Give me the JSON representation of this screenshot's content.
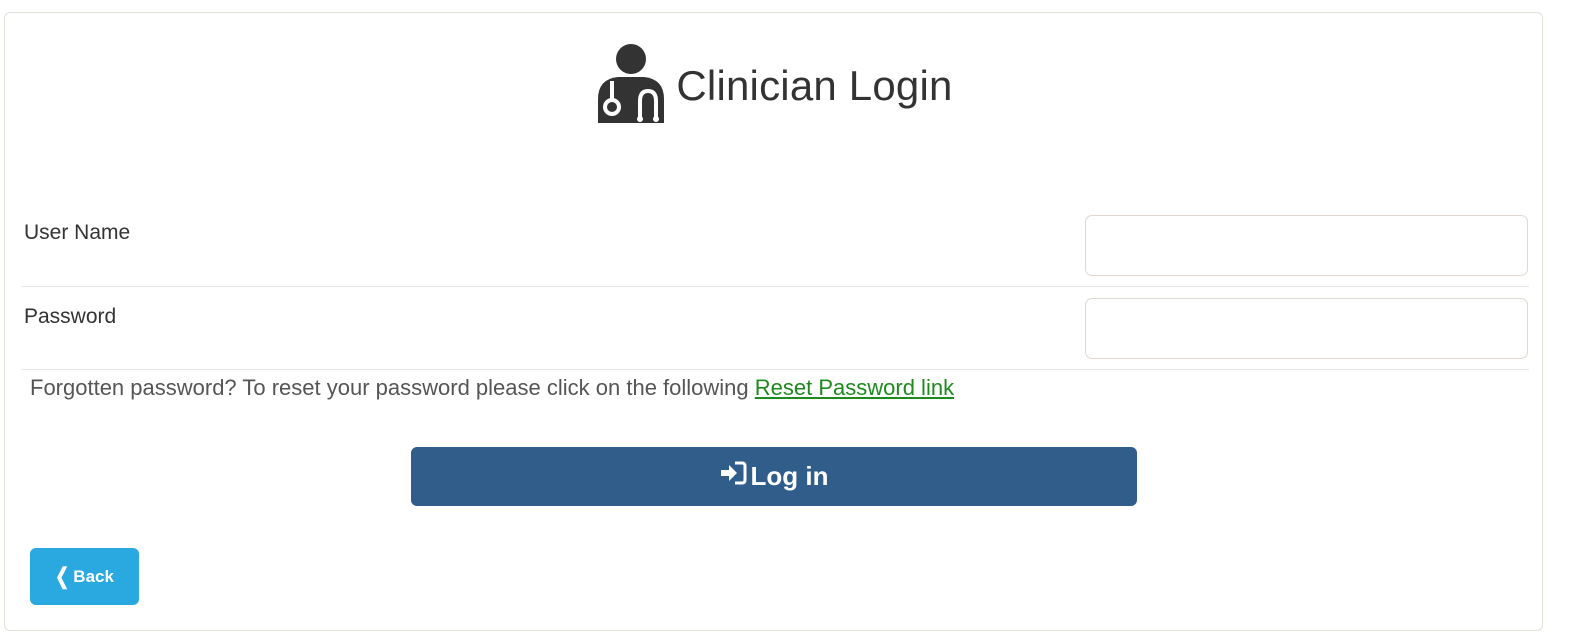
{
  "header": {
    "icon": "doctor-stethoscope-icon",
    "title": "Clinician Login"
  },
  "form": {
    "username_label": "User Name",
    "username_value": "",
    "password_label": "Password",
    "password_value": ""
  },
  "forgot": {
    "text": "Forgotten password? To reset your password please click on the following ",
    "link_label": "Reset Password link"
  },
  "actions": {
    "login_icon": "sign-in-icon",
    "login_label": "Log in",
    "back_icon": "chevron-left-icon",
    "back_label": "Back"
  },
  "colors": {
    "login_button": "#315d8a",
    "back_button": "#2aa8e0",
    "link": "#1e8a1e"
  }
}
